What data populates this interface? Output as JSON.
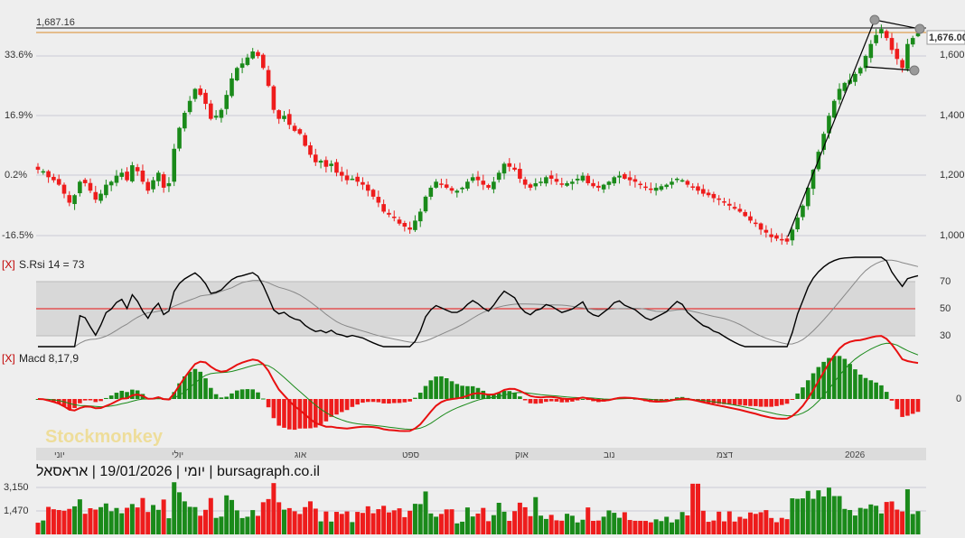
{
  "window": {
    "caption": "יומי | 19/01/2026 | אראסאל | bursagraph.co.il",
    "watermark": "Stockmonkey"
  },
  "price_pane": {
    "last_price_label": "1,676.00",
    "high_line_label": "1,687.16",
    "left_axis_labels": [
      "33.6%",
      "16.9%",
      "0.2%",
      "-16.5%"
    ],
    "right_axis_labels": [
      "1,600",
      "1,400",
      "1,200",
      "1,000"
    ]
  },
  "rsi_pane": {
    "close_label": "[X]",
    "title": "S.Rsi 14 = 73",
    "right_axis_labels": [
      "70",
      "50",
      "30"
    ]
  },
  "macd_pane": {
    "close_label": "[X]",
    "title": "Macd 8,17,9",
    "right_axis_labels": [
      "0"
    ]
  },
  "time_axis": {
    "labels": [
      "יוני",
      "יולי",
      "אוג",
      "ספט",
      "אוק",
      "נוב",
      "דצמ",
      "2026"
    ]
  },
  "volume_pane": {
    "left_axis_labels": [
      "3,150",
      "1,470"
    ]
  },
  "colors": {
    "up": "#1a8a1a",
    "down": "#ee1c1c",
    "rsi_band": "#d8d8d8",
    "high_line": "#d98c2a",
    "signal": "#1a8a1a",
    "macd": "#e81010"
  },
  "chart_data": {
    "type": "candlestick",
    "title": "אראסאל",
    "interval": "יומי",
    "date": "19/01/2026",
    "y_ticks_right": [
      1000,
      1200,
      1400,
      1600
    ],
    "y_ticks_left_pct": [
      -16.5,
      0.2,
      16.9,
      33.6
    ],
    "price_range": [
      970,
      1710
    ],
    "reference_lines": {
      "high": 1687.16,
      "last": 1676.0
    },
    "x_months": [
      "יוני",
      "יולי",
      "אוג",
      "ספט",
      "אוק",
      "נוב",
      "דצמ",
      "2026"
    ],
    "closes": [
      1220,
      1215,
      1195,
      1185,
      1170,
      1140,
      1110,
      1135,
      1180,
      1175,
      1150,
      1120,
      1140,
      1170,
      1180,
      1200,
      1210,
      1185,
      1235,
      1215,
      1180,
      1150,
      1185,
      1210,
      1160,
      1175,
      1290,
      1360,
      1410,
      1450,
      1490,
      1470,
      1440,
      1390,
      1400,
      1420,
      1470,
      1525,
      1560,
      1575,
      1595,
      1615,
      1600,
      1560,
      1500,
      1420,
      1390,
      1400,
      1370,
      1350,
      1340,
      1300,
      1270,
      1245,
      1250,
      1230,
      1240,
      1210,
      1200,
      1185,
      1190,
      1180,
      1170,
      1150,
      1130,
      1110,
      1080,
      1070,
      1060,
      1040,
      1030,
      1020,
      1050,
      1080,
      1130,
      1160,
      1180,
      1170,
      1160,
      1150,
      1150,
      1160,
      1180,
      1195,
      1185,
      1170,
      1160,
      1180,
      1210,
      1240,
      1230,
      1220,
      1190,
      1170,
      1160,
      1175,
      1180,
      1195,
      1190,
      1180,
      1170,
      1175,
      1180,
      1190,
      1200,
      1175,
      1165,
      1160,
      1170,
      1180,
      1195,
      1200,
      1190,
      1185,
      1180,
      1170,
      1160,
      1155,
      1160,
      1165,
      1170,
      1180,
      1190,
      1185,
      1170,
      1160,
      1150,
      1140,
      1135,
      1125,
      1120,
      1110,
      1100,
      1090,
      1080,
      1065,
      1050,
      1040,
      1020,
      1010,
      995,
      990,
      985,
      980,
      1020,
      1060,
      1100,
      1160,
      1220,
      1280,
      1340,
      1400,
      1450,
      1490,
      1510,
      1520,
      1540,
      1560,
      1600,
      1640,
      1670,
      1690,
      1660,
      1620,
      1590,
      1560,
      1640,
      1660,
      1676
    ],
    "rsi_range": [
      20,
      90
    ],
    "rsi_reference": [
      30,
      50,
      70
    ],
    "macd_zero_label": 0,
    "volume_ticks": [
      1470,
      3150
    ]
  }
}
